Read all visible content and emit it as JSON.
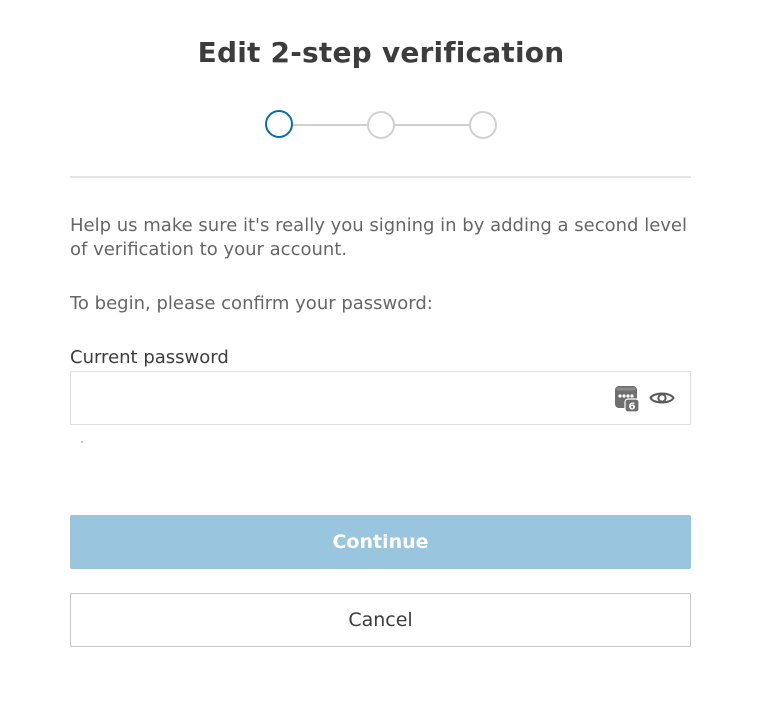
{
  "dialog": {
    "title": "Edit 2-step verification",
    "stepper": {
      "total_steps": 3,
      "current_step": 1
    },
    "intro": "Help us make sure it's really you signing in by adding a second level of verification to your account.",
    "prompt": "To begin, please confirm your password:"
  },
  "password_field": {
    "label": "Current password",
    "value": "",
    "placeholder": "",
    "password_manager_badge": "6"
  },
  "buttons": {
    "continue_label": "Continue",
    "cancel_label": "Cancel"
  },
  "colors": {
    "active_step": "#0a6fa2",
    "inactive_step": "#d0d0d0",
    "continue_disabled_bg": "#9ac5de"
  },
  "icons": {
    "password_manager": "password-manager-icon",
    "show_password": "eye-icon"
  }
}
